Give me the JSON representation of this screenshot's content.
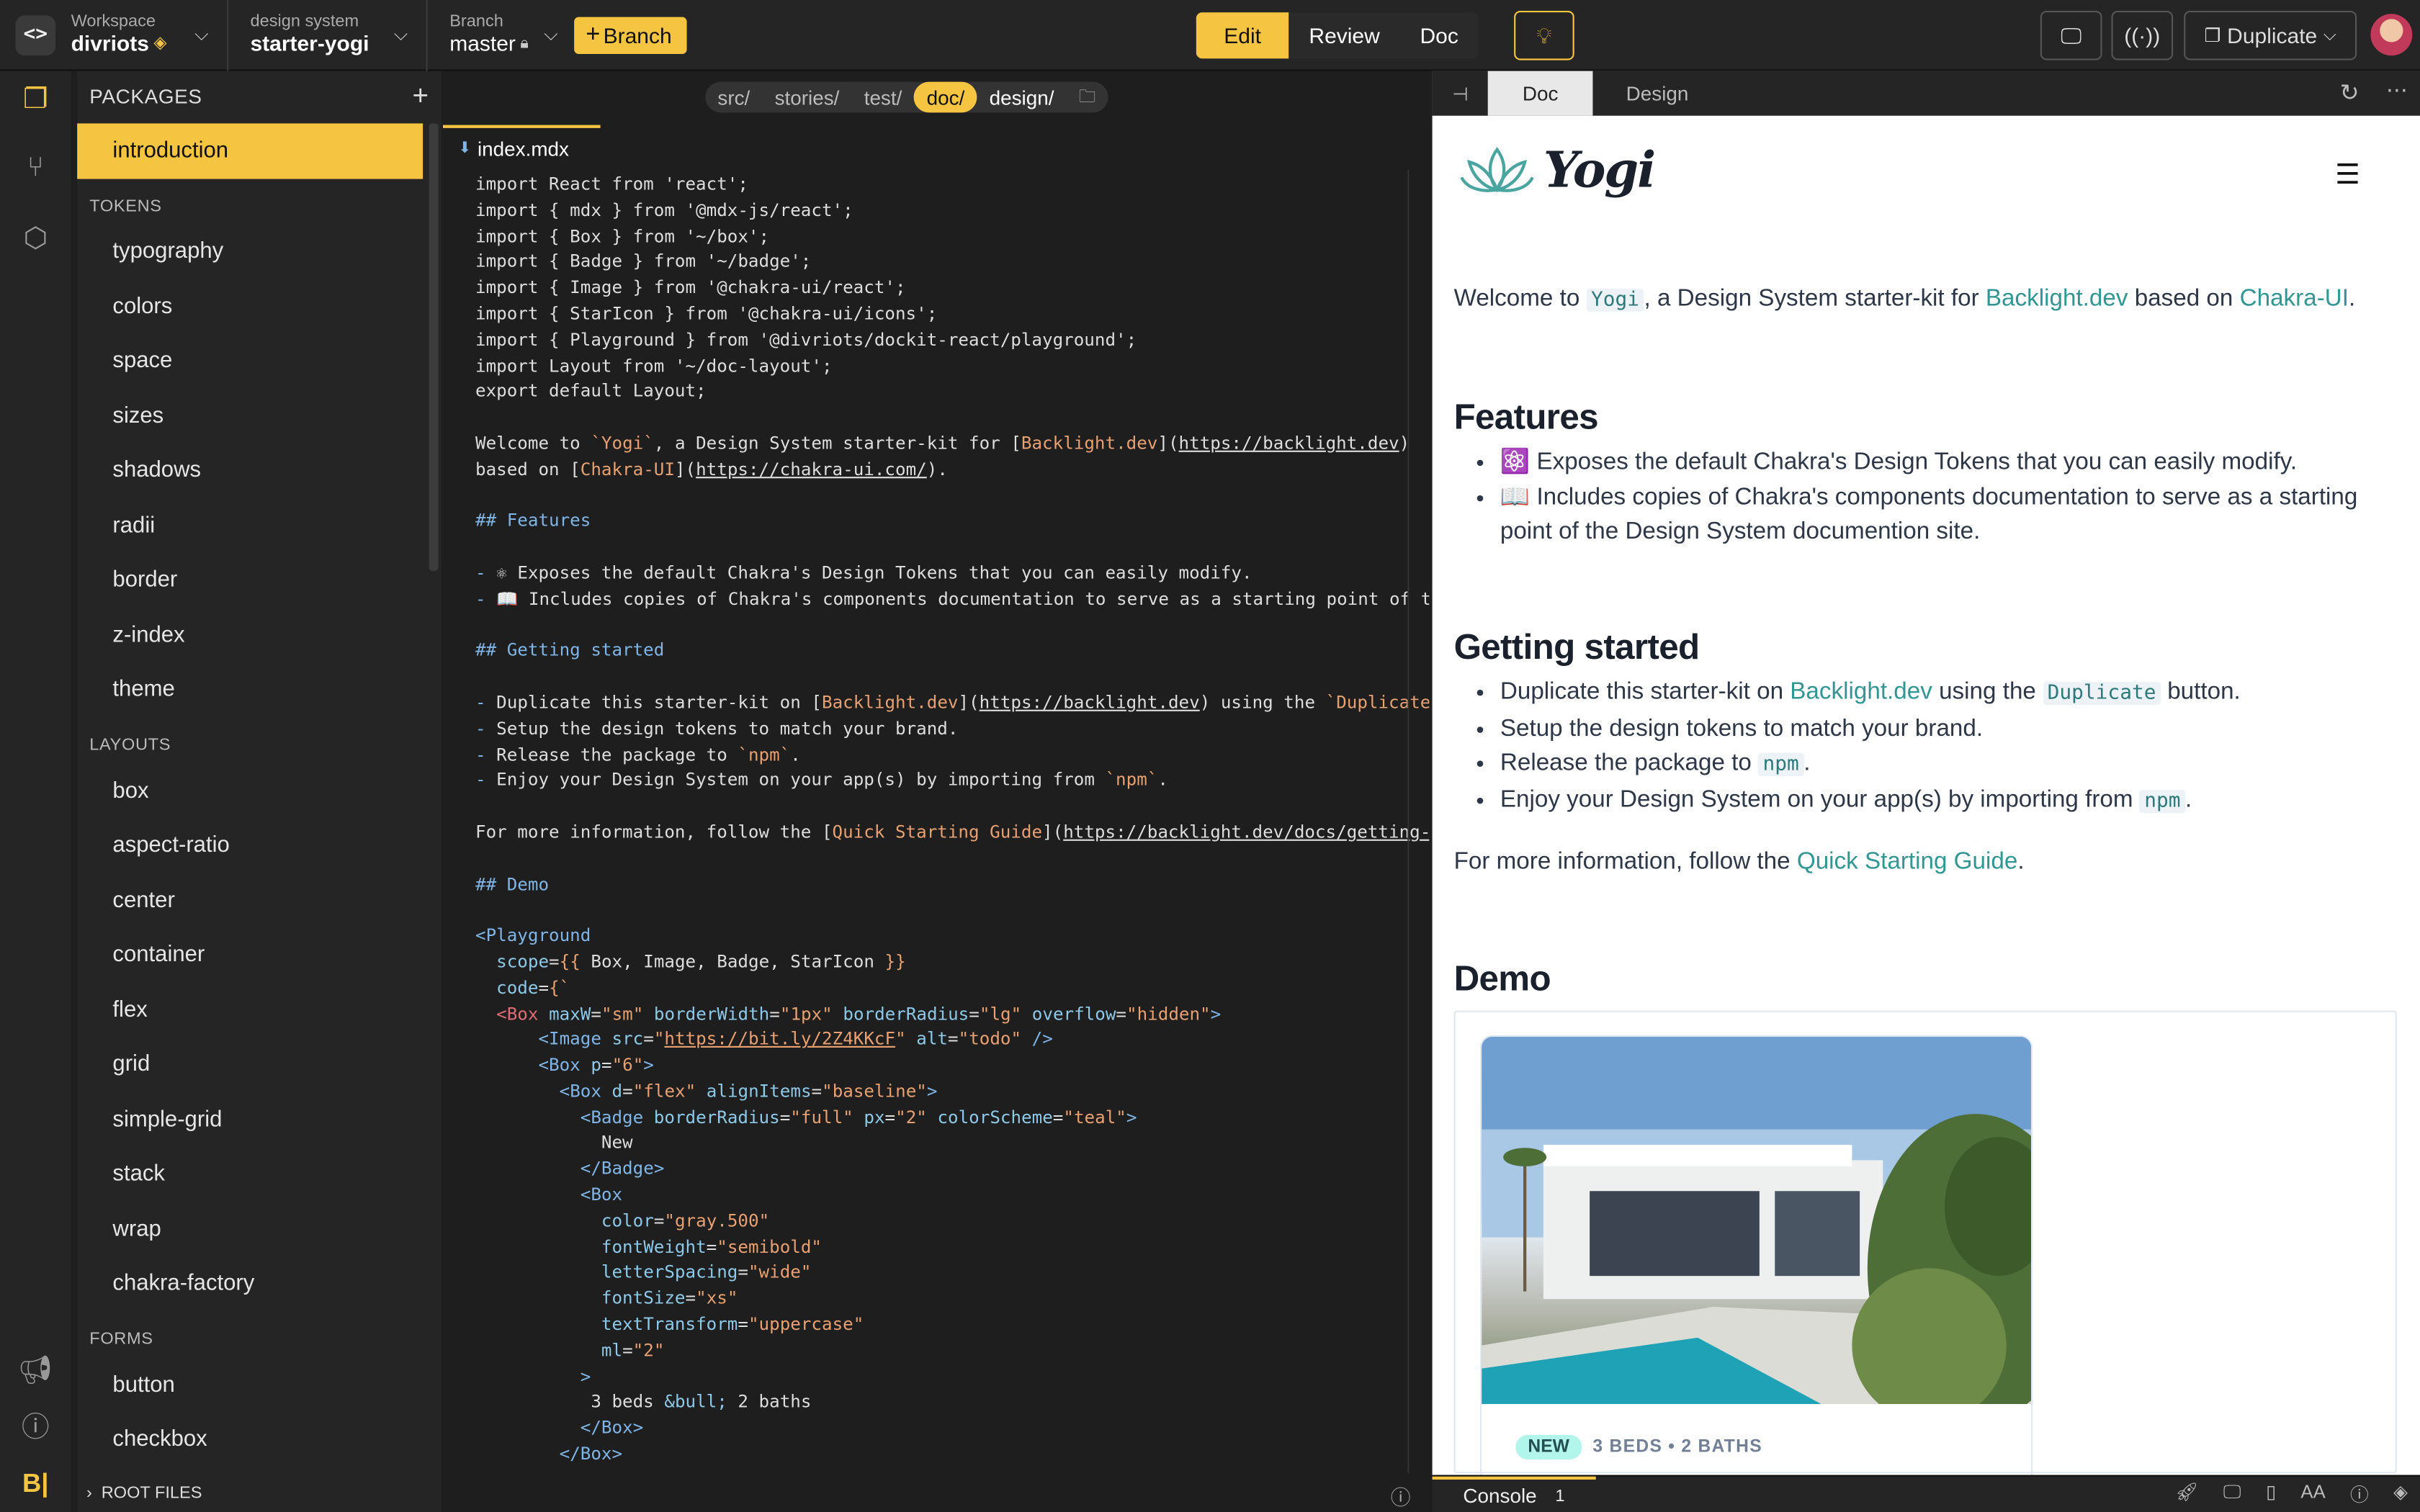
{
  "topbar": {
    "workspace_label": "Workspace",
    "workspace_name": "divriots",
    "design_system_label": "design system",
    "design_system_name": "starter-yogi",
    "branch_label": "Branch",
    "branch_name": "master",
    "new_branch_label": "Branch",
    "modes": [
      "Edit",
      "Review",
      "Doc"
    ],
    "active_mode": "Edit",
    "duplicate_label": "Duplicate"
  },
  "sidebar": {
    "title": "PACKAGES",
    "top_item": "introduction",
    "groups": [
      {
        "label": "TOKENS",
        "items": [
          "typography",
          "colors",
          "space",
          "sizes",
          "shadows",
          "radii",
          "border",
          "z-index",
          "theme"
        ]
      },
      {
        "label": "LAYOUTS",
        "items": [
          "box",
          "aspect-ratio",
          "center",
          "container",
          "flex",
          "grid",
          "simple-grid",
          "stack",
          "wrap",
          "chakra-factory"
        ]
      },
      {
        "label": "FORMS",
        "items": [
          "button",
          "checkbox"
        ]
      }
    ],
    "footer": "ROOT FILES"
  },
  "editor": {
    "breadcrumbs": [
      "src/",
      "stories/",
      "test/",
      "doc/",
      "design/"
    ],
    "active_crumb": "doc/",
    "file_tab": "index.mdx"
  },
  "preview": {
    "tabs": [
      "Doc",
      "Design"
    ],
    "active_tab": "Doc",
    "brand": "Yogi",
    "intro": {
      "pre": "Welcome to ",
      "code": "Yogi",
      "mid": ", a Design System starter-kit for ",
      "link1": "Backlight.dev",
      "mid2": " based on ",
      "link2": "Chakra-UI",
      "end": "."
    },
    "features_heading": "Features",
    "features": [
      "⚛️ Exposes the default Chakra's Design Tokens that you can easily modify.",
      "📖 Includes copies of Chakra's components documentation to serve as a starting point of the Design System documention site."
    ],
    "getting_started_heading": "Getting started",
    "gs1": {
      "pre": "Duplicate this starter-kit on ",
      "link": "Backlight.dev",
      "mid": " using the ",
      "code": "Duplicate",
      "end": " button."
    },
    "gs2": "Setup the design tokens to match your brand.",
    "gs3": {
      "pre": "Release the package to ",
      "code": "npm",
      "end": "."
    },
    "gs4": {
      "pre": "Enjoy your Design System on your app(s) by importing from ",
      "code": "npm",
      "end": "."
    },
    "more": {
      "pre": "For more information, follow the ",
      "link": "Quick Starting Guide",
      "end": "."
    },
    "demo_heading": "Demo",
    "card_badge": "NEW",
    "card_meta": "3 BEDS • 2 BATHS"
  },
  "status": {
    "console_label": "Console",
    "console_count": "1"
  },
  "colors": {
    "accent": "#f5c542",
    "link": "#319795"
  }
}
